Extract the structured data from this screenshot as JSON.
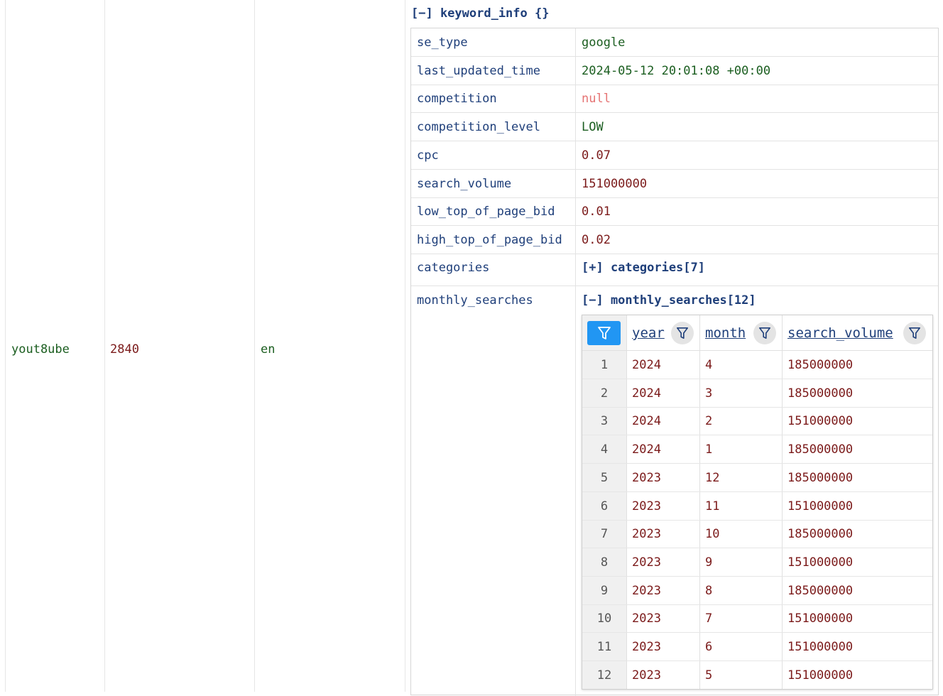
{
  "outer": {
    "keyword": "yout8ube",
    "location_code": "2840",
    "language_code": "en"
  },
  "keyword_info": {
    "toggle_label": "[−] keyword_info {}",
    "rows": [
      {
        "key": "se_type",
        "value": "google",
        "kind": "str"
      },
      {
        "key": "last_updated_time",
        "value": "2024-05-12 20:01:08 +00:00",
        "kind": "str"
      },
      {
        "key": "competition",
        "value": "null",
        "kind": "null"
      },
      {
        "key": "competition_level",
        "value": "LOW",
        "kind": "str"
      },
      {
        "key": "cpc",
        "value": "0.07",
        "kind": "num"
      },
      {
        "key": "search_volume",
        "value": "151000000",
        "kind": "num"
      },
      {
        "key": "low_top_of_page_bid",
        "value": "0.01",
        "kind": "num"
      },
      {
        "key": "high_top_of_page_bid",
        "value": "0.02",
        "kind": "num"
      }
    ],
    "categories": {
      "key": "categories",
      "toggle_label": "[+] categories[7]"
    },
    "monthly_searches": {
      "key": "monthly_searches",
      "toggle_label": "[−] monthly_searches[12]",
      "columns": [
        "year",
        "month",
        "search_volume"
      ],
      "rows": [
        {
          "idx": "1",
          "year": "2024",
          "month": "4",
          "search_volume": "185000000"
        },
        {
          "idx": "2",
          "year": "2024",
          "month": "3",
          "search_volume": "185000000"
        },
        {
          "idx": "3",
          "year": "2024",
          "month": "2",
          "search_volume": "151000000"
        },
        {
          "idx": "4",
          "year": "2024",
          "month": "1",
          "search_volume": "185000000"
        },
        {
          "idx": "5",
          "year": "2023",
          "month": "12",
          "search_volume": "185000000"
        },
        {
          "idx": "6",
          "year": "2023",
          "month": "11",
          "search_volume": "151000000"
        },
        {
          "idx": "7",
          "year": "2023",
          "month": "10",
          "search_volume": "185000000"
        },
        {
          "idx": "8",
          "year": "2023",
          "month": "9",
          "search_volume": "151000000"
        },
        {
          "idx": "9",
          "year": "2023",
          "month": "8",
          "search_volume": "185000000"
        },
        {
          "idx": "10",
          "year": "2023",
          "month": "7",
          "search_volume": "151000000"
        },
        {
          "idx": "11",
          "year": "2023",
          "month": "6",
          "search_volume": "151000000"
        },
        {
          "idx": "12",
          "year": "2023",
          "month": "5",
          "search_volume": "151000000"
        }
      ]
    }
  },
  "colors": {
    "string": "#1b5e20",
    "number": "#7b1a1a",
    "null": "#e57373",
    "key": "#1f3f7a",
    "filter_active": "#2196f3"
  },
  "icons": {
    "filter": "filter-funnel-icon"
  }
}
